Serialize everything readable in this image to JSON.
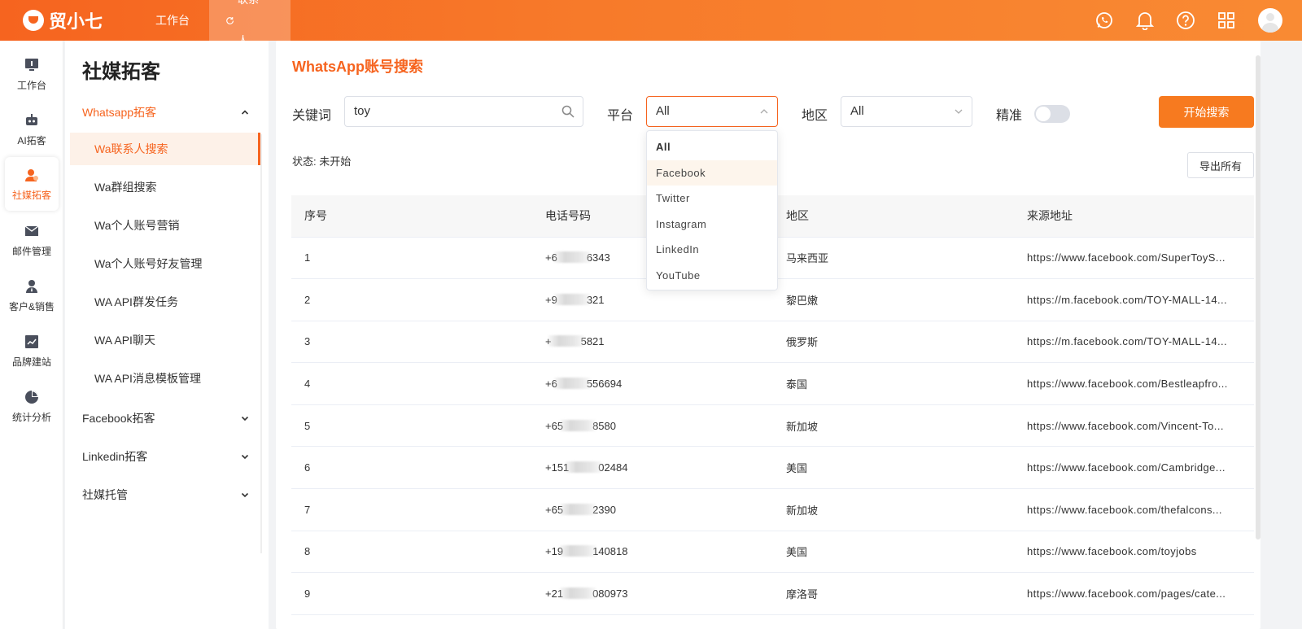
{
  "app": {
    "name": "贸小七"
  },
  "topnav": {
    "workbench": "工作台",
    "current_tab": "联系人..."
  },
  "rail": [
    {
      "label": "工作台",
      "icon": "monitor-icon"
    },
    {
      "label": "AI拓客",
      "icon": "robot-icon"
    },
    {
      "label": "社媒拓客",
      "icon": "user-icon"
    },
    {
      "label": "邮件管理",
      "icon": "mail-icon"
    },
    {
      "label": "客户&销售",
      "icon": "person-tie-icon"
    },
    {
      "label": "品牌建站",
      "icon": "chart-line-icon"
    },
    {
      "label": "统计分析",
      "icon": "pie-chart-icon"
    }
  ],
  "sidebar": {
    "title": "社媒拓客",
    "groups": [
      {
        "label": "Whatsapp拓客"
      },
      {
        "label": "Facebook拓客"
      },
      {
        "label": "Linkedin拓客"
      },
      {
        "label": "社媒托管"
      }
    ],
    "items": [
      {
        "label": "Wa联系人搜索"
      },
      {
        "label": "Wa群组搜索"
      },
      {
        "label": "Wa个人账号营销"
      },
      {
        "label": "Wa个人账号好友管理"
      },
      {
        "label": "WA API群发任务"
      },
      {
        "label": "WA API聊天"
      },
      {
        "label": "WA API消息模板管理"
      }
    ]
  },
  "main": {
    "title": "WhatsApp账号搜索",
    "keyword_label": "关键词",
    "keyword_value": "toy",
    "platform_label": "平台",
    "platform_value": "All",
    "region_label": "地区",
    "region_value": "All",
    "exact_label": "精准",
    "exact_on": false,
    "search_button": "开始搜索",
    "status_text": "状态: 未开始",
    "export_button": "导出所有",
    "accent_color": "#f6641f"
  },
  "platform_options": [
    "All",
    "Facebook",
    "Twitter",
    "Instagram",
    "LinkedIn",
    "YouTube"
  ],
  "table": {
    "headers": [
      "序号",
      "电话号码",
      "地区",
      "来源地址"
    ],
    "rows": [
      {
        "no": "1",
        "phone_a": "+6",
        "phone_b": "6343",
        "region": "马来西亚",
        "url": "https://www.facebook.com/SuperToyS..."
      },
      {
        "no": "2",
        "phone_a": "+9",
        "phone_b": "321",
        "region": "黎巴嫩",
        "url": "https://m.facebook.com/TOY-MALL-14..."
      },
      {
        "no": "3",
        "phone_a": "+",
        "phone_b": "5821",
        "region": "俄罗斯",
        "url": "https://m.facebook.com/TOY-MALL-14..."
      },
      {
        "no": "4",
        "phone_a": "+6",
        "phone_b": "556694",
        "region": "泰国",
        "url": "https://www.facebook.com/Bestleapfro..."
      },
      {
        "no": "5",
        "phone_a": "+65",
        "phone_b": "8580",
        "region": "新加坡",
        "url": "https://www.facebook.com/Vincent-To..."
      },
      {
        "no": "6",
        "phone_a": "+151",
        "phone_b": "02484",
        "region": "美国",
        "url": "https://www.facebook.com/Cambridge..."
      },
      {
        "no": "7",
        "phone_a": "+65",
        "phone_b": "2390",
        "region": "新加坡",
        "url": "https://www.facebook.com/thefalcons..."
      },
      {
        "no": "8",
        "phone_a": "+19",
        "phone_b": "140818",
        "region": "美国",
        "url": "https://www.facebook.com/toyjobs"
      },
      {
        "no": "9",
        "phone_a": "+21",
        "phone_b": "080973",
        "region": "摩洛哥",
        "url": "https://www.facebook.com/pages/cate..."
      }
    ]
  }
}
